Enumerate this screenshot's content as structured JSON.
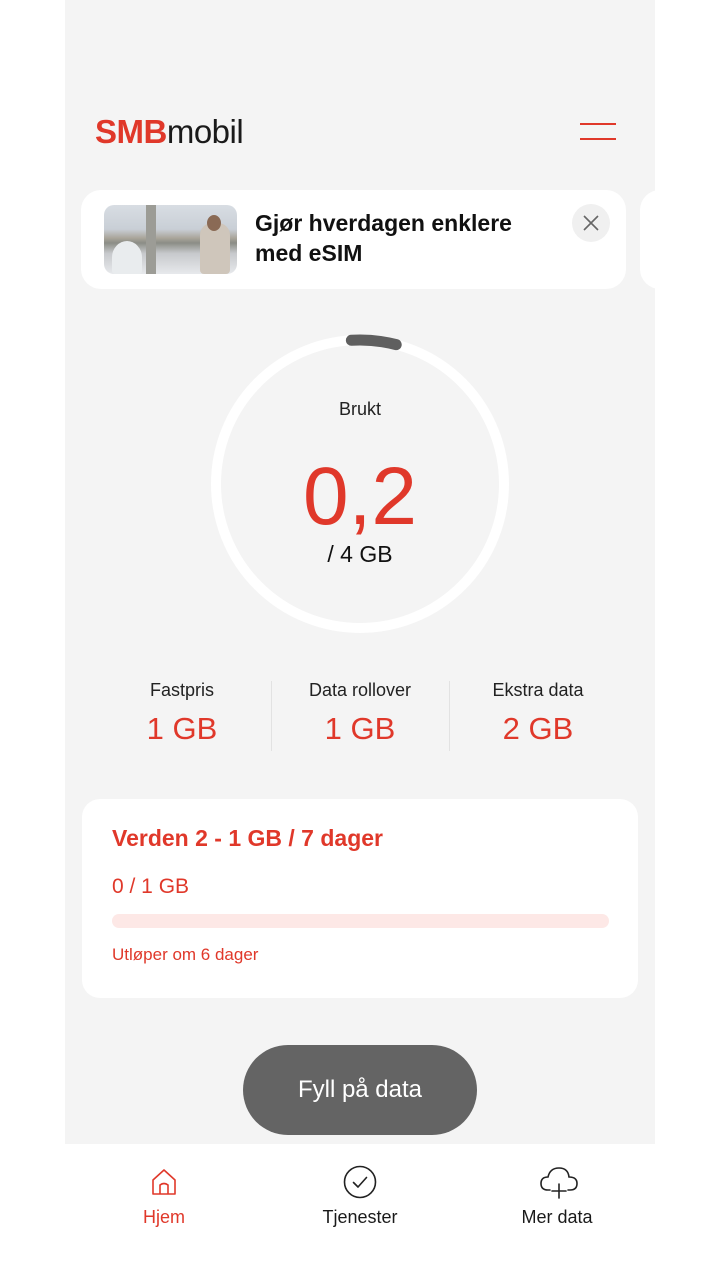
{
  "header": {
    "brand_bold": "SMB",
    "brand_light": "mobil",
    "menu_icon": "hamburger-icon"
  },
  "banner": {
    "title": "Gjør hverdagen enklere med eSIM",
    "close_icon": "close-icon"
  },
  "usage": {
    "label": "Brukt",
    "used": "0,2",
    "total": "/ 4 GB",
    "used_fraction": 0.05
  },
  "stats": [
    {
      "label": "Fastpris",
      "value": "1 GB"
    },
    {
      "label": "Data rollover",
      "value": "1 GB"
    },
    {
      "label": "Ekstra data",
      "value": "2 GB"
    }
  ],
  "package": {
    "title": "Verden 2 - 1 GB / 7 dager",
    "usage": "0 / 1 GB",
    "progress_fraction": 0,
    "expiry": "Utløper om 6 dager"
  },
  "fill_button": {
    "label": "Fyll på data"
  },
  "nav": {
    "home": {
      "label": "Hjem",
      "icon": "home-icon"
    },
    "services": {
      "label": "Tjenester",
      "icon": "check-circle-icon"
    },
    "more": {
      "label": "Mer data",
      "icon": "cloud-plus-icon"
    }
  },
  "colors": {
    "accent": "#e0382a",
    "background": "#f4f4f4",
    "button": "#646464",
    "progress_track": "#fde8e6"
  }
}
